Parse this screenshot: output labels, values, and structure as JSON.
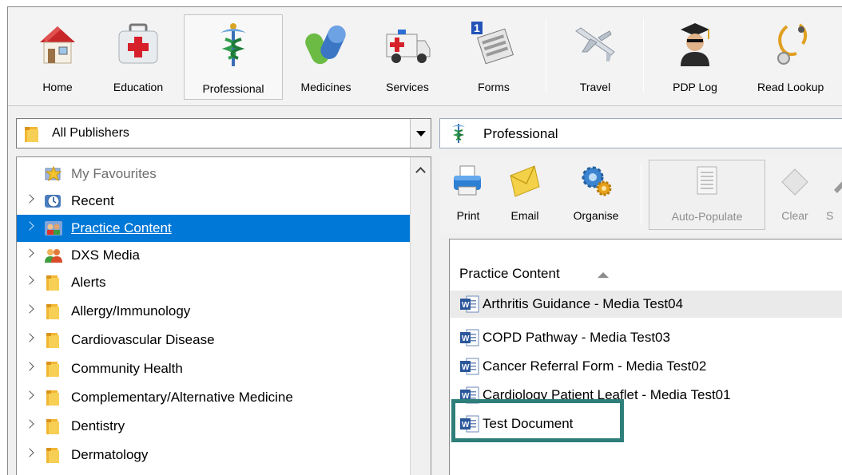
{
  "ribbon": {
    "items": [
      {
        "label": "Home",
        "icon": "house-icon"
      },
      {
        "label": "Education",
        "icon": "first-aid-kit-icon"
      },
      {
        "label": "Professional",
        "icon": "caduceus-icon",
        "active": true
      },
      {
        "label": "Medicines",
        "icon": "pills-icon"
      },
      {
        "label": "Services",
        "icon": "ambulance-icon"
      },
      {
        "label": "Forms",
        "icon": "forms-icon",
        "badge": "1"
      },
      {
        "label": "Travel",
        "icon": "airplane-icon"
      },
      {
        "label": "PDP Log",
        "icon": "graduate-icon"
      },
      {
        "label": "Read Lookup",
        "icon": "stethoscope-icon"
      }
    ]
  },
  "publisher": {
    "selected": "All Publishers"
  },
  "tree": {
    "items": [
      {
        "label": "My Favourites",
        "icon": "favourites-icon"
      },
      {
        "label": "Recent",
        "icon": "clock-icon"
      },
      {
        "label": "Practice Content",
        "icon": "practice-icon",
        "selected": true
      },
      {
        "label": "DXS Media",
        "icon": "media-users-icon"
      },
      {
        "label": "Alerts",
        "icon": "folder-icon"
      },
      {
        "label": "Allergy/Immunology",
        "icon": "folder-icon"
      },
      {
        "label": "Cardiovascular Disease",
        "icon": "folder-icon"
      },
      {
        "label": "Community Health",
        "icon": "folder-icon"
      },
      {
        "label": "Complementary/Alternative Medicine",
        "icon": "folder-icon"
      },
      {
        "label": "Dentistry",
        "icon": "folder-icon"
      },
      {
        "label": "Dermatology",
        "icon": "folder-icon"
      }
    ]
  },
  "content_header": {
    "title": "Professional"
  },
  "toolbar": {
    "print": "Print",
    "email": "Email",
    "organise": "Organise",
    "auto_populate": "Auto-Populate",
    "clear": "Clear",
    "s": "S"
  },
  "documents": {
    "column_header": "Practice Content",
    "items": [
      "Arthritis Guidance - Media Test04",
      "COPD Pathway - Media Test03",
      "Cancer Referral Form - Media Test02",
      "Cardiology Patient Leaflet - Media Test01",
      "Test Document"
    ]
  },
  "colors": {
    "selection": "#0078d7",
    "highlight_box": "#2e7f7a"
  }
}
